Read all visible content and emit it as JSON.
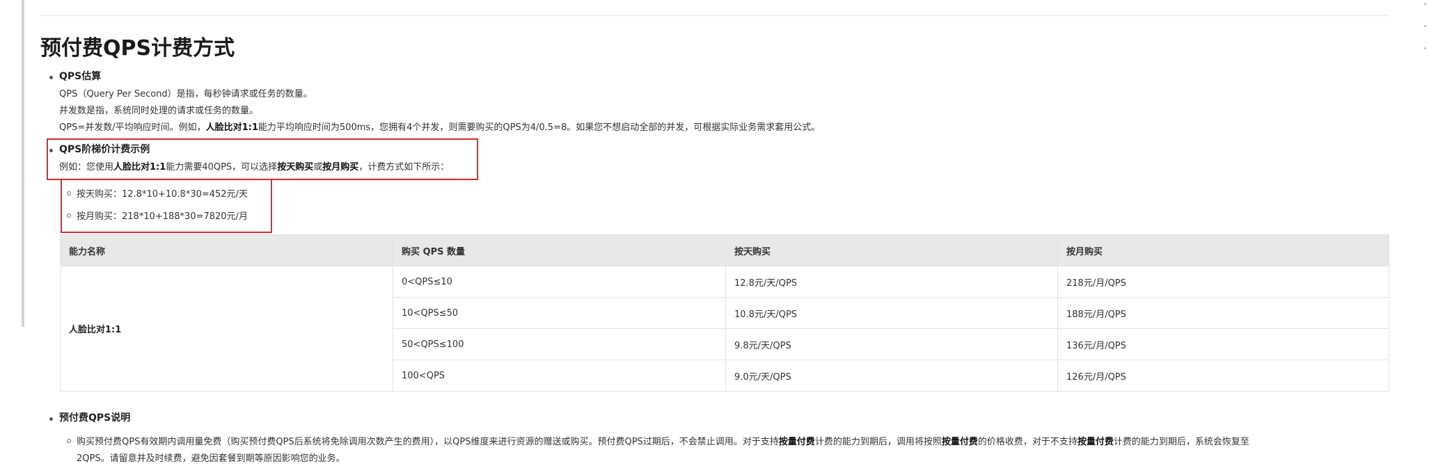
{
  "title": "预付费QPS计费方式",
  "qps_estimate": {
    "heading": "QPS估算",
    "line1": "QPS（Query Per Second）是指，每秒钟请求或任务的数量。",
    "line2": "并发数是指，系统同时处理的请求或任务的数量。",
    "line3": {
      "a": "QPS=并发数/平均响应时间。例如，",
      "b": "人脸比对1:1",
      "c": "能力平均响应时间为500ms，您拥有4个并发，则需要购买的QPS为4/0.5=8。如果您不想启动全部的并发，可根据实际业务需求套用公式。"
    }
  },
  "tier_example": {
    "heading": "QPS阶梯价计费示例",
    "intro": {
      "a": "例如：您使用",
      "b": "人脸比对1:1",
      "c": "能力需要40QPS，可以选择",
      "d": "按天购买",
      "e": "或",
      "f": "按月购买",
      "g": "，计费方式如下所示："
    },
    "items": [
      "按天购买：12.8*10+10.8*30=452元/天",
      "按月购买：218*10+188*30=7820元/月"
    ]
  },
  "table": {
    "headers": [
      "能力名称",
      "购买 QPS 数量",
      "按天购买",
      "按月购买"
    ],
    "capability": "人脸比对1:1",
    "rows": [
      [
        "0<QPS≤10",
        "12.8元/天/QPS",
        "218元/月/QPS"
      ],
      [
        "10<QPS≤50",
        "10.8元/天/QPS",
        "188元/月/QPS"
      ],
      [
        "50<QPS≤100",
        "9.8元/天/QPS",
        "136元/月/QPS"
      ],
      [
        "100<QPS",
        "9.0元/天/QPS",
        "126元/月/QPS"
      ]
    ]
  },
  "prepaid_note": {
    "heading": "预付费QPS说明",
    "p1": {
      "a": "购买预付费QPS有效期内调用量免费（购买预付费QPS后系统将免除调用次数产生的费用），以QPS维度来进行资源的赠送或购买。预付费QPS过期后，不会禁止调用。对于支持",
      "b": "按量付费",
      "c": "计费的能力到期后，调用将按照",
      "d": "按量付费",
      "e": "的价格收费，对于不支持",
      "f": "按量付费",
      "g": "计费的能力到期后，系统会恢复至"
    },
    "p2": "2QPS。请留意并及时续费，避免因套餐到期等原因影响您的业务。"
  }
}
